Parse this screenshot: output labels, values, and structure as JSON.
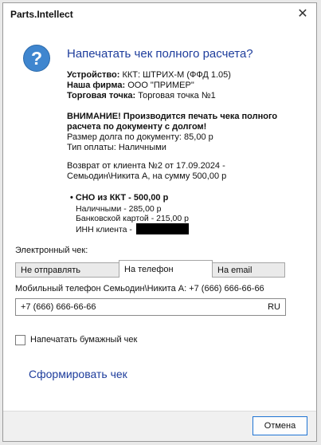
{
  "window": {
    "title": "Parts.Intellect",
    "close_glyph": "✕"
  },
  "question_icon_glyph": "?",
  "heading": "Напечатать чек полного расчета?",
  "info": {
    "device_label": "Устройство:",
    "device_value": "ККТ: ШТРИХ-М (ФФД 1.05)",
    "company_label": "Наша фирма:",
    "company_value": "ООО \"ПРИМЕР\"",
    "point_label": "Торговая точка:",
    "point_value": "Торговая точка №1"
  },
  "warning": {
    "line1": "ВНИМАНИЕ! Производится печать чека полного",
    "line2": "расчета по документу с долгом!",
    "debt": "Размер долга по документу: 85,00 р",
    "payment_type": "Тип оплаты: Наличными"
  },
  "refund": {
    "line1": "Возврат от клиента №2 от 17.09.2024 -",
    "line2": "Семьодин\\Никита А, на сумму 500,00 р"
  },
  "sno": {
    "bullet": "•",
    "title": "СНО из ККТ - 500,00 р",
    "cash": "Наличными - 285,00 р",
    "card": "Банковской картой - 215,00 р",
    "inn_label": "ИНН клиента - "
  },
  "electronic_receipt": {
    "label": "Электронный чек:",
    "tabs": [
      "Не отправлять",
      "На телефон",
      "На email"
    ],
    "active_tab": 1
  },
  "phone": {
    "label": "Мобильный телефон Семьодин\\Никита А: +7 (666) 666-66-66",
    "value": "+7 (666) 666-66-66",
    "country": "RU"
  },
  "print_paper": {
    "label": "Напечатать бумажный чек",
    "checked": false
  },
  "generate_link": "Сформировать чек",
  "cancel_button": "Отмена",
  "icons": {
    "question": "question-icon",
    "close": "close-icon"
  }
}
